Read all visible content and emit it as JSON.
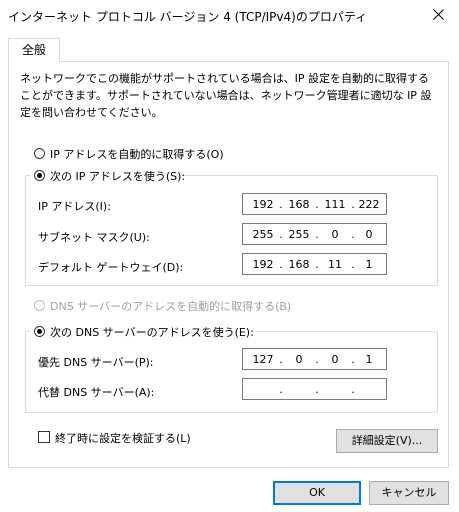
{
  "window": {
    "title": "インターネット プロトコル バージョン 4 (TCP/IPv4)のプロパティ"
  },
  "tab": {
    "label": "全般"
  },
  "description": "ネットワークでこの機能がサポートされている場合は、IP 設定を自動的に取得することができます。サポートされていない場合は、ネットワーク管理者に適切な IP 設定を問い合わせてください。",
  "ip_section": {
    "auto_label": "IP アドレスを自動的に取得する(O)",
    "auto_selected": false,
    "manual_label": "次の IP アドレスを使う(S):",
    "manual_selected": true,
    "fields": {
      "ip": {
        "label": "IP アドレス(I):",
        "octets": [
          "192",
          "168",
          "111",
          "222"
        ]
      },
      "mask": {
        "label": "サブネット マスク(U):",
        "octets": [
          "255",
          "255",
          "0",
          "0"
        ]
      },
      "gateway": {
        "label": "デフォルト ゲートウェイ(D):",
        "octets": [
          "192",
          "168",
          "11",
          "1"
        ]
      }
    }
  },
  "dns_section": {
    "auto_label": "DNS サーバーのアドレスを自動的に取得する(B)",
    "auto_disabled": true,
    "manual_label": "次の DNS サーバーのアドレスを使う(E):",
    "manual_selected": true,
    "fields": {
      "preferred": {
        "label": "優先 DNS サーバー(P):",
        "octets": [
          "127",
          "0",
          "0",
          "1"
        ]
      },
      "alternate": {
        "label": "代替 DNS サーバー(A):",
        "octets": [
          "",
          "",
          "",
          ""
        ]
      }
    }
  },
  "validate_on_exit": {
    "label": "終了時に設定を検証する(L)",
    "checked": false
  },
  "buttons": {
    "advanced": "詳細設定(V)...",
    "ok": "OK",
    "cancel": "キャンセル"
  },
  "separator_dot": "."
}
